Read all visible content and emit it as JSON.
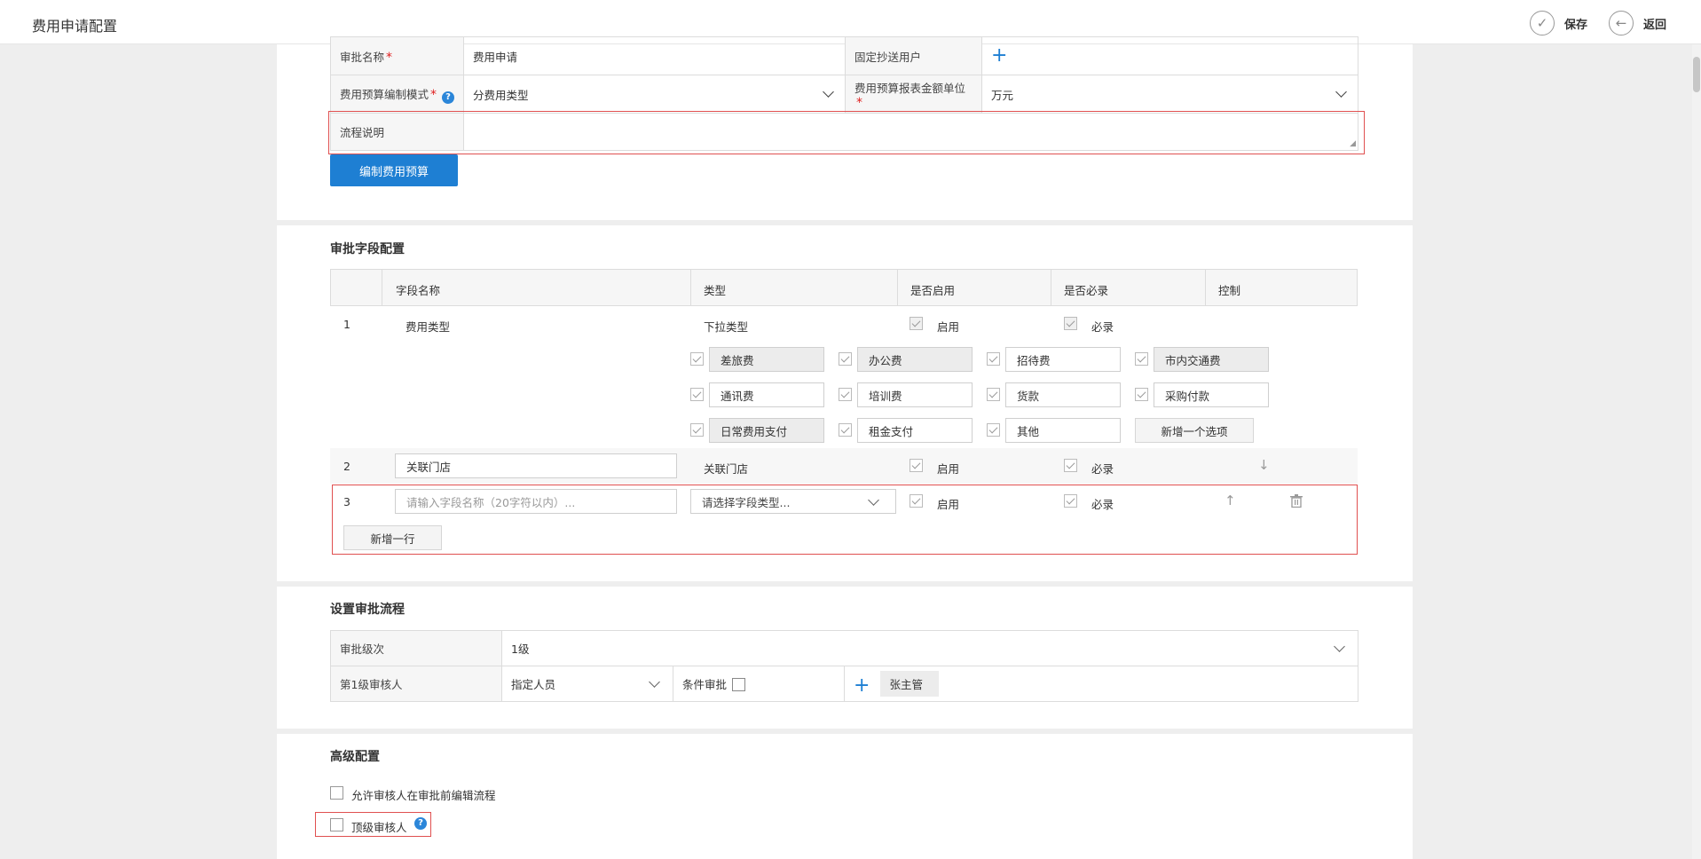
{
  "header": {
    "title": "费用申请配置",
    "save_label": "保存",
    "back_label": "返回"
  },
  "basic": {
    "approval_name_label": "审批名称",
    "approval_name_value": "费用申请",
    "cc_label": "固定抄送用户",
    "budget_mode_label": "费用预算编制模式",
    "budget_mode_value": "分费用类型",
    "unit_label": "费用预算报表金额单位",
    "unit_value": "万元",
    "flow_desc_label": "流程说明",
    "flow_desc_value": "",
    "edit_budget_button": "编制费用预算"
  },
  "fields": {
    "title": "审批字段配置",
    "columns": [
      "字段名称",
      "类型",
      "是否启用",
      "是否必录",
      "控制"
    ],
    "enable_label": "启用",
    "required_label": "必录",
    "row1": {
      "index": "1",
      "name": "费用类型",
      "type": "下拉类型"
    },
    "options": [
      "差旅费",
      "办公费",
      "招待费",
      "市内交通费",
      "通讯费",
      "培训费",
      "货款",
      "采购付款",
      "日常费用支付",
      "租金支付",
      "其他"
    ],
    "add_option_button": "新增一个选项",
    "row2": {
      "index": "2",
      "name": "关联门店",
      "type": "关联门店"
    },
    "row3": {
      "index": "3",
      "name_placeholder": "请输入字段名称（20字符以内）...",
      "type_placeholder": "请选择字段类型..."
    },
    "add_row_button": "新增一行"
  },
  "flow": {
    "title": "设置审批流程",
    "level_label": "审批级次",
    "level_value": "1级",
    "reviewer_label": "第1级审核人",
    "reviewer_type": "指定人员",
    "conditional_label": "条件审批",
    "reviewer_tag": "张主管"
  },
  "advanced": {
    "title": "高级配置",
    "allow_edit_label": "允许审核人在审批前编辑流程",
    "top_reviewer_label": "顶级审核人"
  },
  "colors": {
    "accent": "#1e7fd3",
    "highlight": "#e05050"
  }
}
